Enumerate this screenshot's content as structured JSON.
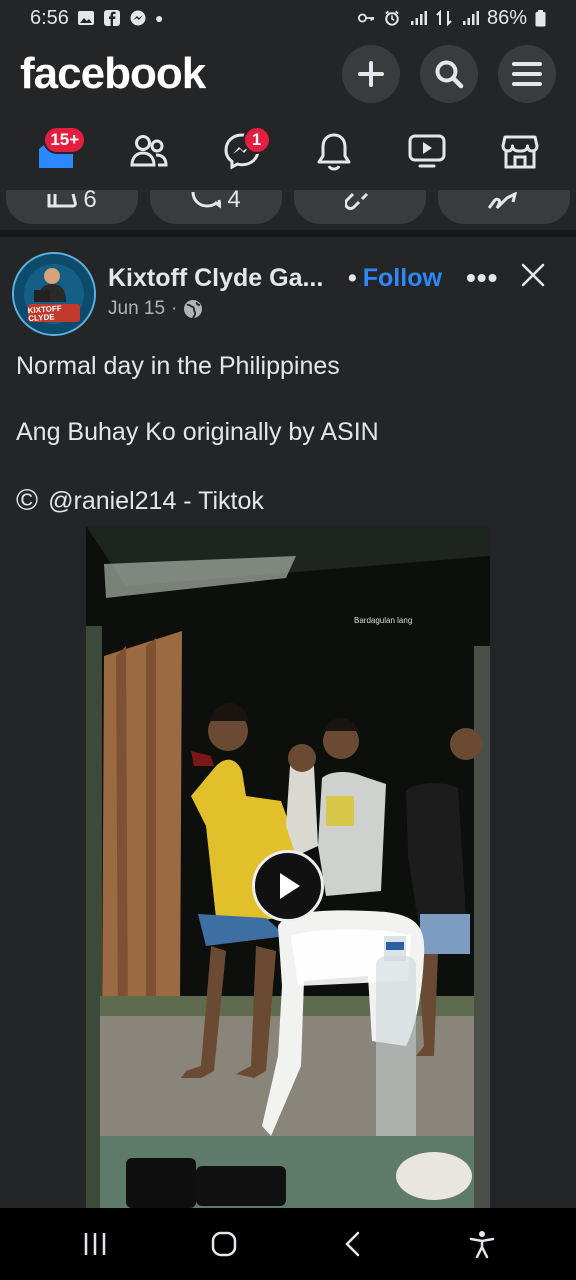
{
  "status_bar": {
    "time": "6:56",
    "battery": "86%"
  },
  "header": {
    "logo": "facebook",
    "actions": [
      "create-icon",
      "search-icon",
      "menu-icon"
    ]
  },
  "nav": {
    "items": [
      {
        "name": "home",
        "badge": "15+"
      },
      {
        "name": "friends",
        "badge": ""
      },
      {
        "name": "messenger",
        "badge": "1"
      },
      {
        "name": "notifications",
        "badge": ""
      },
      {
        "name": "watch",
        "badge": ""
      },
      {
        "name": "marketplace",
        "badge": ""
      }
    ]
  },
  "prev_post_actions": {
    "like_count": "6",
    "comment_count": "4"
  },
  "post": {
    "author": "Kixtoff Clyde Ga...",
    "bullet": "•",
    "follow_label": "Follow",
    "date": "Jun 15",
    "dot": "·",
    "more_label": "•••",
    "lines": [
      "Normal day in the Philippines",
      "Ang Buhay Ko originally by ASIN",
      "@raniel214 - Tiktok"
    ],
    "copyright_symbol": "©",
    "avatar_text": [
      "KIXTOFF",
      "CLYDE"
    ],
    "video_caption": "Bardagulan lang"
  },
  "colors": {
    "background": "#242526",
    "accent": "#2d88ff",
    "badge": "#e41e3f"
  }
}
